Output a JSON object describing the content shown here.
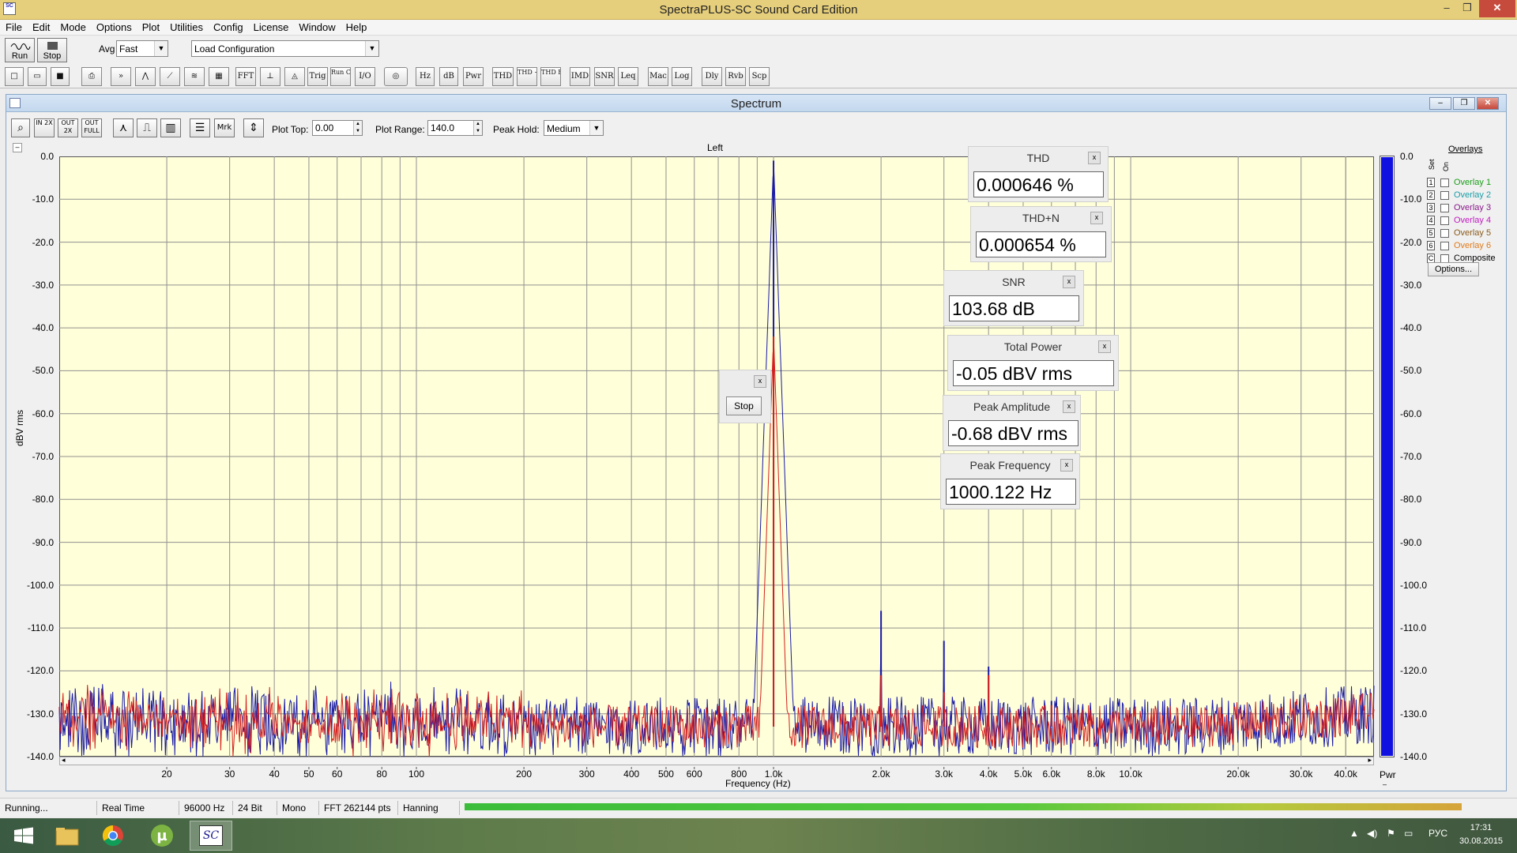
{
  "window": {
    "title": "SpectraPLUS-SC Sound Card Edition",
    "app_icon_text": "SC"
  },
  "window_controls": {
    "minimize": "–",
    "restore": "❐",
    "close": "✕"
  },
  "menu": [
    "File",
    "Edit",
    "Mode",
    "Options",
    "Plot",
    "Utilities",
    "Config",
    "License",
    "Window",
    "Help"
  ],
  "toolbar": {
    "run_label": "Run",
    "stop_label": "Stop",
    "avg_label": "Avg",
    "avg_value": "Fast",
    "load_config": "Load Configuration",
    "buttons": [
      "",
      "",
      "",
      "",
      "",
      "",
      "",
      "",
      "",
      "",
      "FFT",
      "",
      "",
      "Trig",
      "Run Ctrl",
      "I/O",
      "",
      "Hz",
      "dB",
      "Pwr",
      "THD",
      "THD +N",
      "THD Freq",
      "IMD",
      "SNR",
      "Leq",
      "Mac",
      "Log",
      "Dly",
      "Rvb",
      "Scp"
    ]
  },
  "spectrum": {
    "title": "Spectrum",
    "toolbar": [
      "",
      "IN 2X",
      "OUT 2X",
      "OUT FULL",
      "",
      "",
      "",
      "",
      "Mrk",
      ""
    ],
    "plot_top_label": "Plot Top:",
    "plot_top_value": "0.00",
    "plot_range_label": "Plot Range:",
    "plot_range_value": "140.0",
    "peak_hold_label": "Peak Hold:",
    "peak_hold_value": "Medium",
    "channel_label": "Left",
    "collapse_glyph": "–"
  },
  "chart_data": {
    "type": "line",
    "title": "Left",
    "xlabel": "Frequency (Hz)",
    "ylabel": "dBV rms",
    "x_scale": "log",
    "xlim": [
      10,
      48000
    ],
    "ylim": [
      -140,
      0
    ],
    "y_ticks": [
      "0.0",
      "-10.0",
      "-20.0",
      "-30.0",
      "-40.0",
      "-50.0",
      "-60.0",
      "-70.0",
      "-80.0",
      "-90.0",
      "-100.0",
      "-110.0",
      "-120.0",
      "-130.0",
      "-140.0"
    ],
    "x_ticks": [
      {
        "f": 20,
        "label": "20"
      },
      {
        "f": 30,
        "label": "30"
      },
      {
        "f": 40,
        "label": "40"
      },
      {
        "f": 50,
        "label": "50"
      },
      {
        "f": 60,
        "label": "60"
      },
      {
        "f": 80,
        "label": "80"
      },
      {
        "f": 100,
        "label": "100"
      },
      {
        "f": 200,
        "label": "200"
      },
      {
        "f": 300,
        "label": "300"
      },
      {
        "f": 400,
        "label": "400"
      },
      {
        "f": 500,
        "label": "500"
      },
      {
        "f": 600,
        "label": "600"
      },
      {
        "f": 800,
        "label": "800"
      },
      {
        "f": 1000,
        "label": "1.0k"
      },
      {
        "f": 2000,
        "label": "2.0k"
      },
      {
        "f": 3000,
        "label": "3.0k"
      },
      {
        "f": 4000,
        "label": "4.0k"
      },
      {
        "f": 5000,
        "label": "5.0k"
      },
      {
        "f": 6000,
        "label": "6.0k"
      },
      {
        "f": 8000,
        "label": "8.0k"
      },
      {
        "f": 10000,
        "label": "10.0k"
      },
      {
        "f": 20000,
        "label": "20.0k"
      },
      {
        "f": 30000,
        "label": "30.0k"
      },
      {
        "f": 40000,
        "label": "40.0k"
      }
    ],
    "right_axis_label": "Pwr",
    "grid": true,
    "noise_floor_db": -133,
    "series": [
      {
        "color": "#1a1aa8",
        "peaks": [
          [
            1000,
            -1
          ],
          [
            2000,
            -106
          ],
          [
            3000,
            -113
          ],
          [
            4000,
            -119
          ],
          [
            6000,
            -127
          ]
        ]
      },
      {
        "color": "#d42020",
        "peaks": [
          [
            1000,
            -42
          ],
          [
            2000,
            -121
          ],
          [
            3000,
            -125
          ],
          [
            4000,
            -121
          ],
          [
            6000,
            -128
          ]
        ]
      }
    ],
    "power_bar": {
      "color": "#1010e0",
      "level_db": -0.05
    }
  },
  "overlays": {
    "title": "Overlays",
    "col_set": "Set",
    "col_on": "On",
    "items": [
      {
        "num": "1",
        "name": "Overlay 1",
        "color": "#1a9e1a"
      },
      {
        "num": "2",
        "name": "Overlay 2",
        "color": "#1a9ea8"
      },
      {
        "num": "3",
        "name": "Overlay 3",
        "color": "#8a1a8a"
      },
      {
        "num": "4",
        "name": "Overlay 4",
        "color": "#c01ac0"
      },
      {
        "num": "5",
        "name": "Overlay 5",
        "color": "#8a5a1a"
      },
      {
        "num": "6",
        "name": "Overlay 6",
        "color": "#e07a1a"
      },
      {
        "num": "C",
        "name": "Composite",
        "color": "#000000"
      }
    ],
    "options_label": "Options..."
  },
  "measurements": {
    "thd": {
      "title": "THD",
      "value": "0.000646 %"
    },
    "thdn": {
      "title": "THD+N",
      "value": "0.000654 %"
    },
    "snr": {
      "title": "SNR",
      "value": "103.68 dB"
    },
    "total_power": {
      "title": "Total Power",
      "value": "-0.05 dBV rms"
    },
    "peak_amplitude": {
      "title": "Peak Amplitude",
      "value": "-0.68 dBV rms"
    },
    "peak_frequency": {
      "title": "Peak Frequency",
      "value": "1000.122 Hz"
    },
    "close_glyph": "x"
  },
  "stop_panel": {
    "label": "Stop",
    "close_glyph": "x"
  },
  "status": {
    "state": "Running...",
    "mode": "Real Time",
    "rate": "96000 Hz",
    "bits": "24 Bit",
    "channels": "Mono",
    "fft": "FFT 262144 pts",
    "window": "Hanning"
  },
  "taskbar": {
    "lang": "РУС",
    "time": "17:31",
    "date": "30.08.2015",
    "sc_label": "SC"
  }
}
